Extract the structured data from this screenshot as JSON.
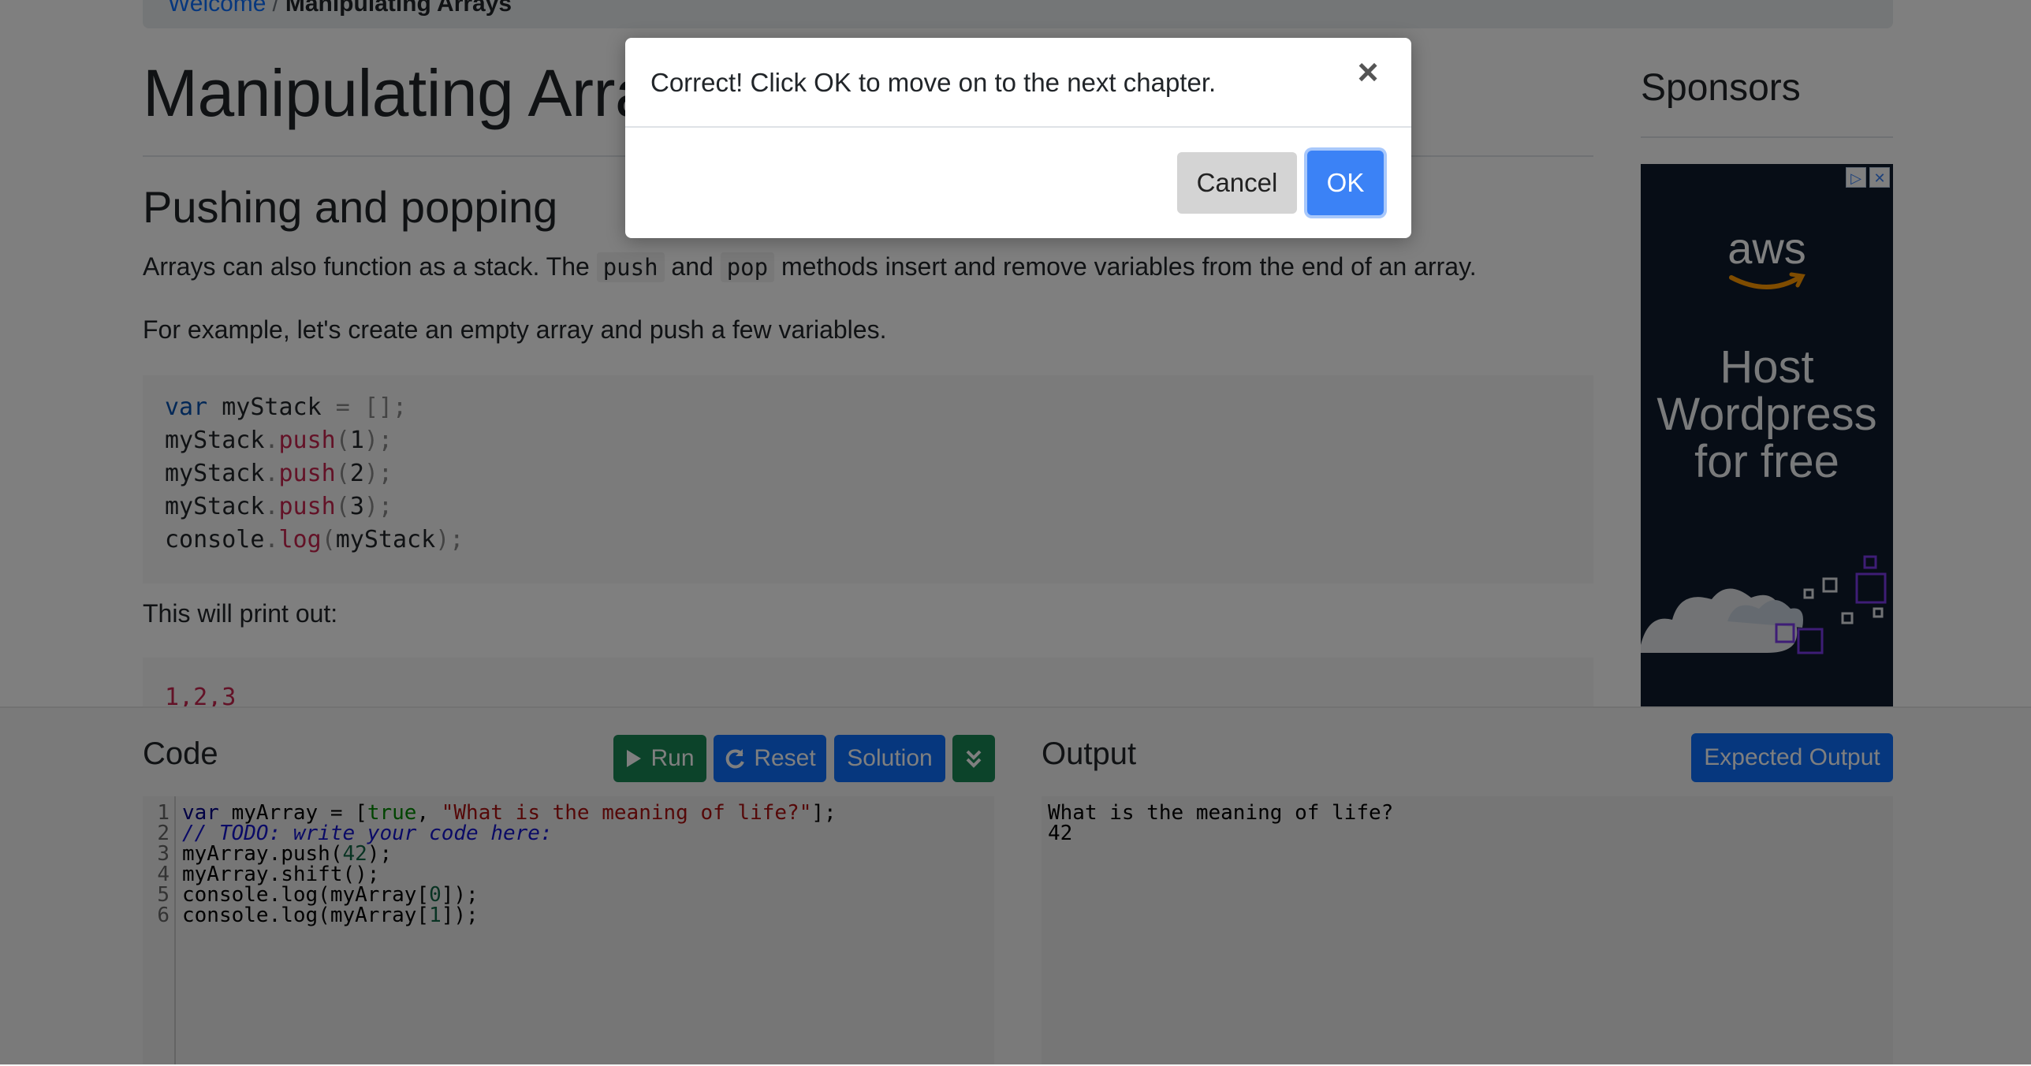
{
  "breadcrumb": {
    "home": "Welcome",
    "separator": "/",
    "current": "Manipulating Arrays"
  },
  "lesson": {
    "title": "Manipulating Arrays",
    "section_title": "Pushing and popping",
    "para1_before": "Arrays can also function as a stack. The ",
    "para1_code1": "push",
    "para1_middle": " and ",
    "para1_code2": "pop",
    "para1_after": " methods insert and remove variables from the end of an array.",
    "para2": "For example, let's create an empty array and push a few variables.",
    "code_example": {
      "line1": {
        "kw": "var",
        "a": " myStack ",
        "b": "=",
        "c": " ",
        "d": "[];"
      },
      "pushes": [
        {
          "obj": "myStack",
          "dot": ".",
          "fn": "push",
          "open": "(",
          "arg": "1",
          "close": ");"
        },
        {
          "obj": "myStack",
          "dot": ".",
          "fn": "push",
          "open": "(",
          "arg": "2",
          "close": ");"
        },
        {
          "obj": "myStack",
          "dot": ".",
          "fn": "push",
          "open": "(",
          "arg": "3",
          "close": ");"
        }
      ],
      "log": {
        "obj": "console",
        "dot": ".",
        "fn": "log",
        "open": "(",
        "arg": "myStack",
        "close": ");"
      }
    },
    "para3": "This will print out:",
    "output_example": "1,2,3"
  },
  "sidebar": {
    "title": "Sponsors",
    "ad": {
      "logo": "aws",
      "text": "Host\nWordpress\nfor free",
      "ctrl_info": "▷",
      "ctrl_close": "✕"
    }
  },
  "code_panel": {
    "title": "Code",
    "buttons": {
      "run": "Run",
      "reset": "Reset",
      "solution": "Solution",
      "expand": "⌄"
    },
    "line_numbers": [
      "1",
      "2",
      "3",
      "4",
      "5",
      "6"
    ],
    "lines": {
      "l1_kw": "var",
      "l1_a": " myArray = [",
      "l1_bool": "true",
      "l1_b": ", ",
      "l1_str": "\"What is the meaning of life?\"",
      "l1_c": "];",
      "l2": "// TODO: write your code here:",
      "l3_a": "myArray.push(",
      "l3_num": "42",
      "l3_b": ");",
      "l4": "myArray.shift();",
      "l5_a": "console.log(myArray[",
      "l5_num": "0",
      "l5_b": "]);",
      "l6_a": "console.log(myArray[",
      "l6_num": "1",
      "l6_b": "]);"
    }
  },
  "output_panel": {
    "title": "Output",
    "expected_button": "Expected Output",
    "lines": [
      "What is the meaning of life?",
      "42"
    ]
  },
  "modal": {
    "message": "Correct! Click OK to move on to the next chapter.",
    "close": "×",
    "cancel": "Cancel",
    "ok": "OK"
  },
  "colors": {
    "primary": "#0d6efd",
    "success": "#198754",
    "ok_button": "#3b82f6",
    "overlay": "rgba(0,0,0,0.5)"
  }
}
